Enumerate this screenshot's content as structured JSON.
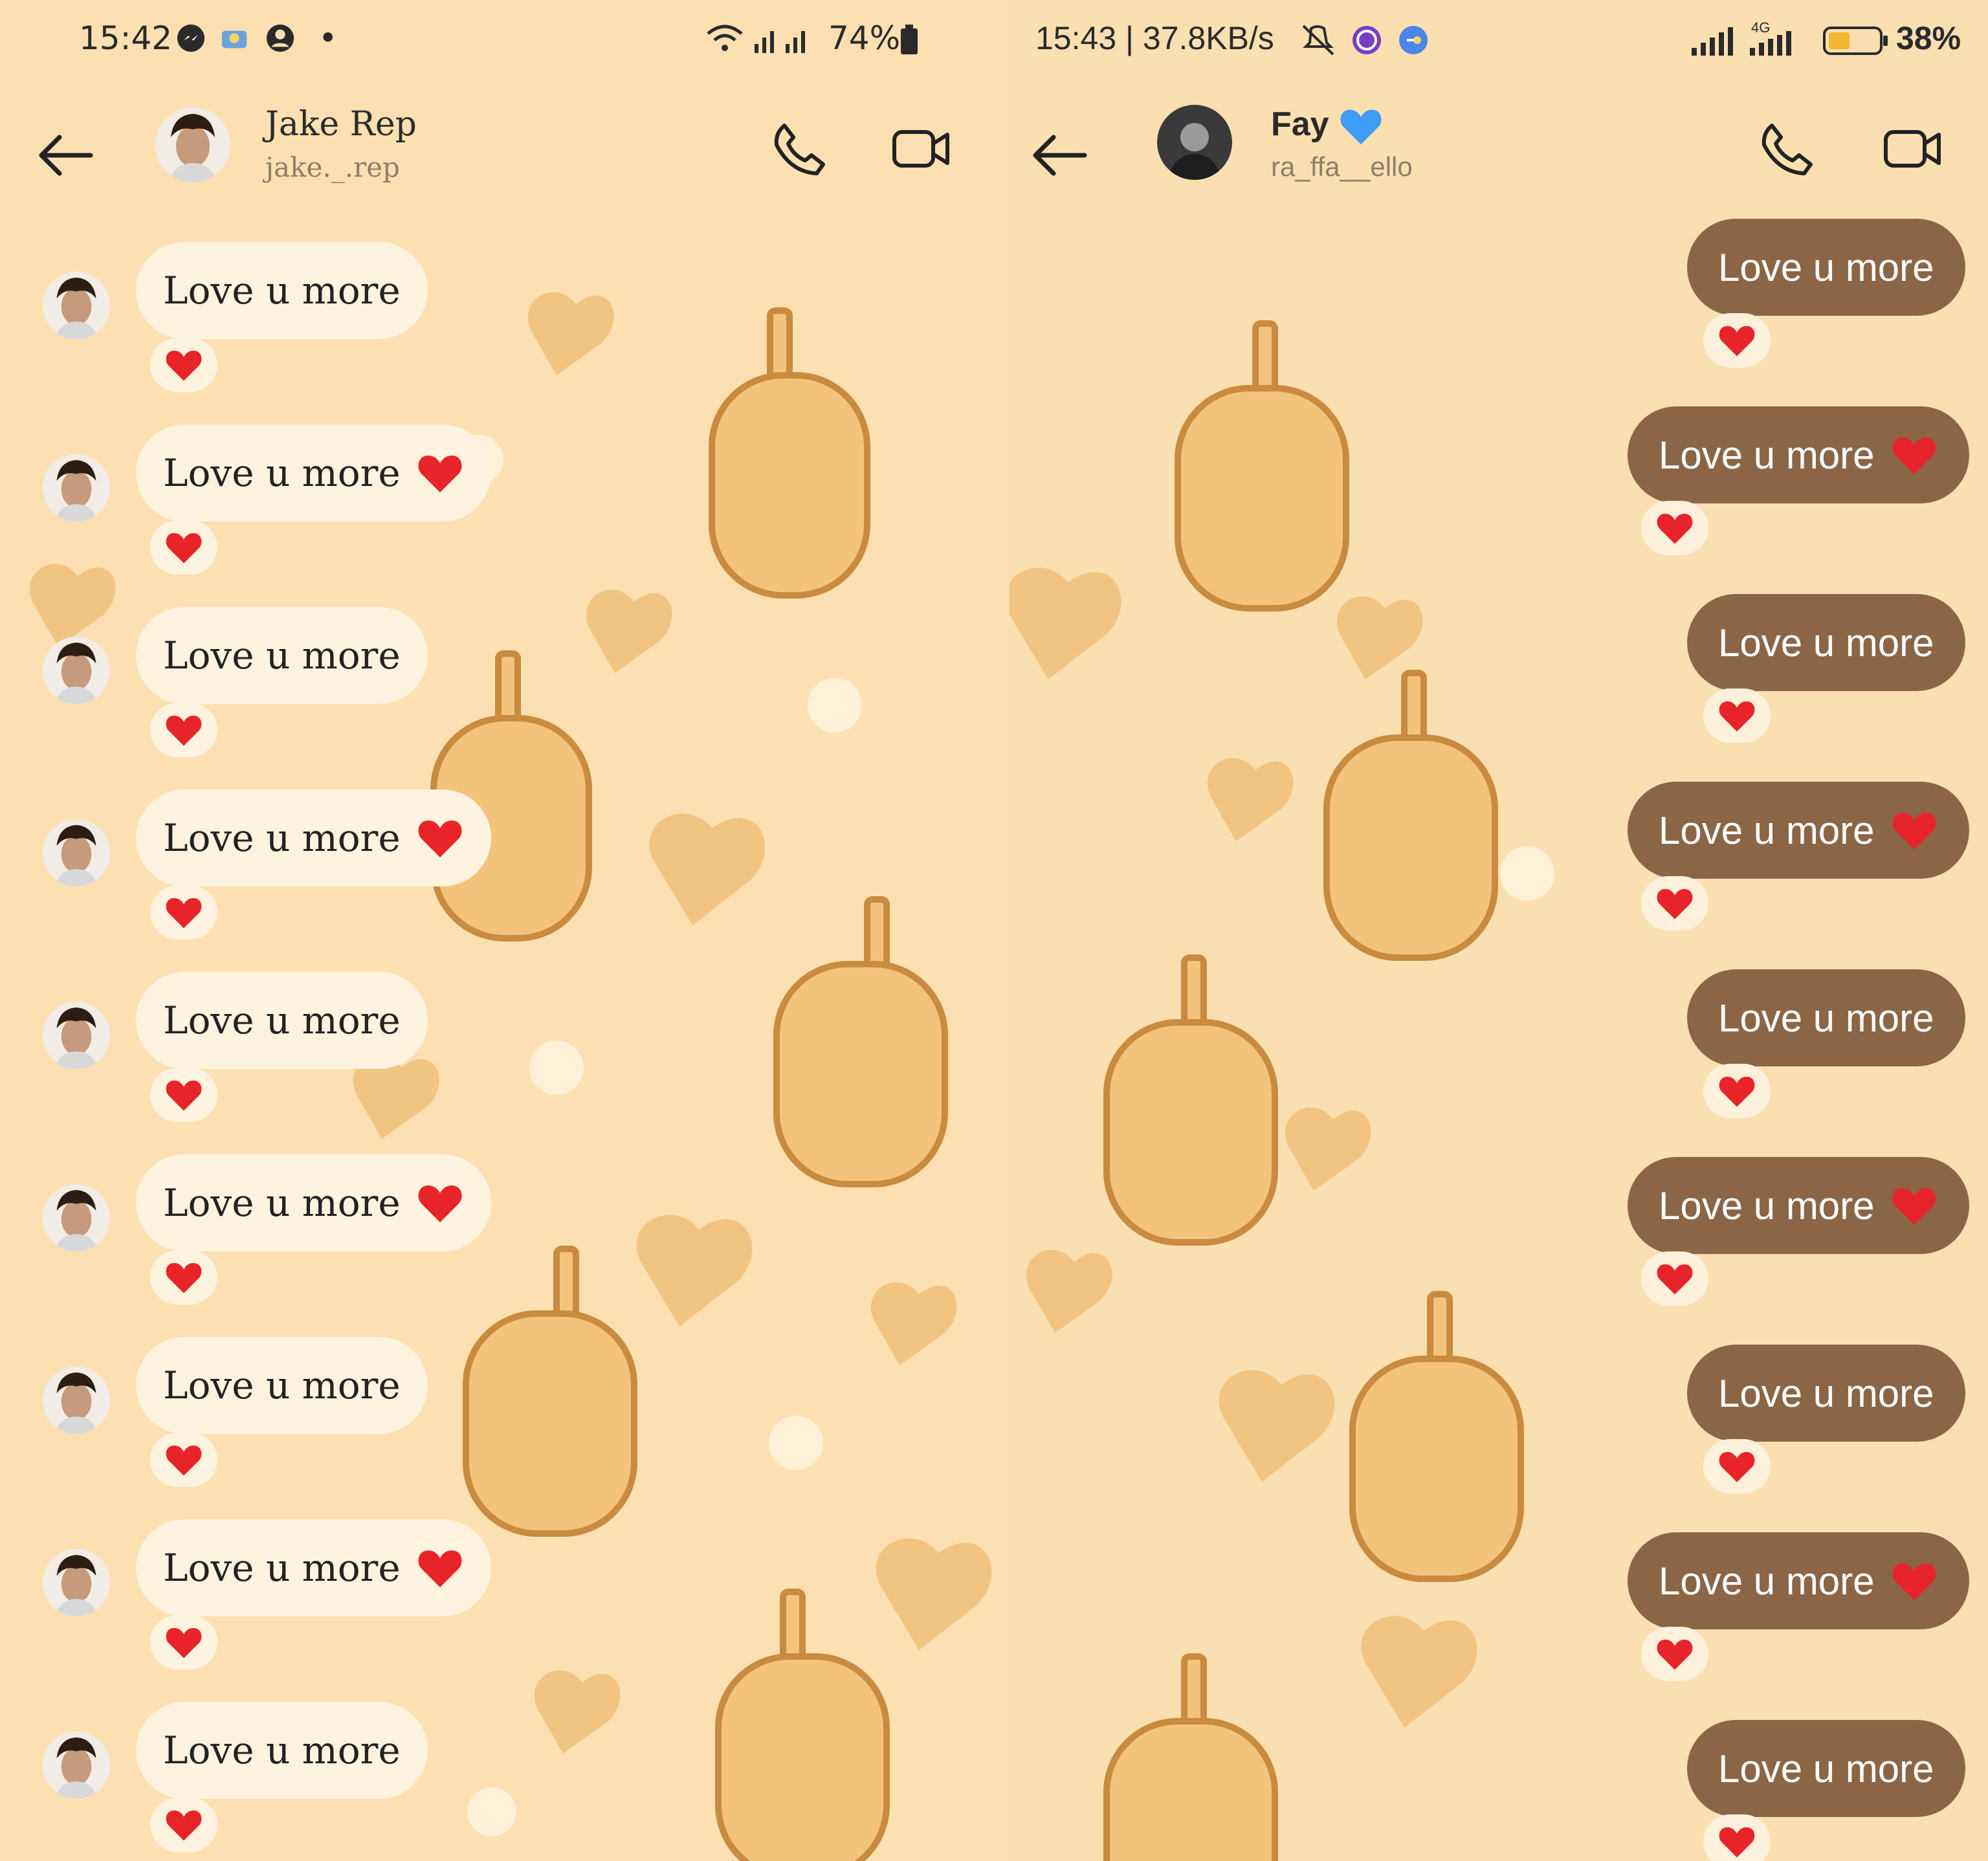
{
  "left": {
    "status": {
      "time": "15:42",
      "battery": "74%"
    },
    "header": {
      "name": "Jake Rep",
      "handle": "jake._.rep"
    },
    "messages": [
      {
        "text": "Love u more",
        "heart": false,
        "reaction": "❤"
      },
      {
        "text": "Love u more",
        "heart": true,
        "reaction": "❤"
      },
      {
        "text": "Love u more",
        "heart": false,
        "reaction": "❤"
      },
      {
        "text": "Love u more",
        "heart": true,
        "reaction": "❤"
      },
      {
        "text": "Love u more",
        "heart": false,
        "reaction": "❤"
      },
      {
        "text": "Love u more",
        "heart": true,
        "reaction": "❤"
      },
      {
        "text": "Love u more",
        "heart": false,
        "reaction": "❤"
      },
      {
        "text": "Love u more",
        "heart": true,
        "reaction": "❤"
      },
      {
        "text": "Love u more",
        "heart": false,
        "reaction": "❤"
      }
    ]
  },
  "right": {
    "status": {
      "time_speed": "15:43 | 37.8KB/s",
      "network": "4G",
      "battery": "38%"
    },
    "header": {
      "name": "Fay",
      "handle": "ra_ffa__ello"
    },
    "messages": [
      {
        "text": "Love u more",
        "heart": false,
        "reaction": "❤"
      },
      {
        "text": "Love u more",
        "heart": true,
        "reaction": "❤"
      },
      {
        "text": "Love u more",
        "heart": false,
        "reaction": "❤"
      },
      {
        "text": "Love u more",
        "heart": true,
        "reaction": "❤"
      },
      {
        "text": "Love u more",
        "heart": false,
        "reaction": "❤"
      },
      {
        "text": "Love u more",
        "heart": true,
        "reaction": "❤"
      },
      {
        "text": "Love u more",
        "heart": false,
        "reaction": "❤"
      },
      {
        "text": "Love u more",
        "heart": true,
        "reaction": "❤"
      },
      {
        "text": "Love u more",
        "heart": false,
        "reaction": "❤"
      }
    ]
  },
  "colors": {
    "background": "#fce0b2",
    "incoming_bubble": "#fef3de",
    "outgoing_bubble": "#8a6647",
    "heart": "#e8242b",
    "verified_heart": "#3d9cf5",
    "pattern": "#e6ac5e"
  },
  "icons": [
    "back-arrow-icon",
    "phone-icon",
    "video-camera-icon",
    "messenger-icon",
    "user-circle-icon",
    "wifi-icon",
    "signal-icon",
    "battery-icon",
    "mute-icon",
    "red-heart-icon",
    "blue-heart-icon"
  ]
}
